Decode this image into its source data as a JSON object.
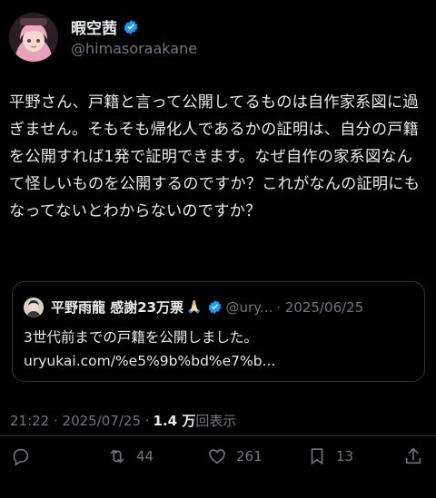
{
  "author": {
    "display_name": "暇空茜",
    "handle": "@himasoraakane",
    "verified": true
  },
  "tweet": {
    "text": "平野さん、戸籍と言って公開してるものは自作家系図に過ぎません。そもそも帰化人であるかの証明は、自分の戸籍を公開すれば1発で証明できます。なぜ自作の家系図なんて怪しいものを公開するのですか？これがなんの証明にもなってないとわからないのですか？"
  },
  "quote": {
    "display_name": "平野雨龍 感謝23万票",
    "emoji": "🙏🏻",
    "handle": "@ury...",
    "date_sep": "· 2025/06/25",
    "text_line1": "3世代前までの戸籍を公開しました。",
    "text_line2": "uryukai.com/%e5%9b%bd%e7%b..."
  },
  "meta": {
    "timestamp": "21:22 · 2025/07/25 ·",
    "views_count": "1.4 万",
    "views_label": "回表示"
  },
  "actions": {
    "replies": "",
    "retweets": "44",
    "likes": "261",
    "bookmarks": "13"
  },
  "colors": {
    "background": "#000000",
    "text": "#e7e9ea",
    "muted": "#71767b",
    "border": "#2f3336",
    "verified": "#1d9bf0"
  }
}
